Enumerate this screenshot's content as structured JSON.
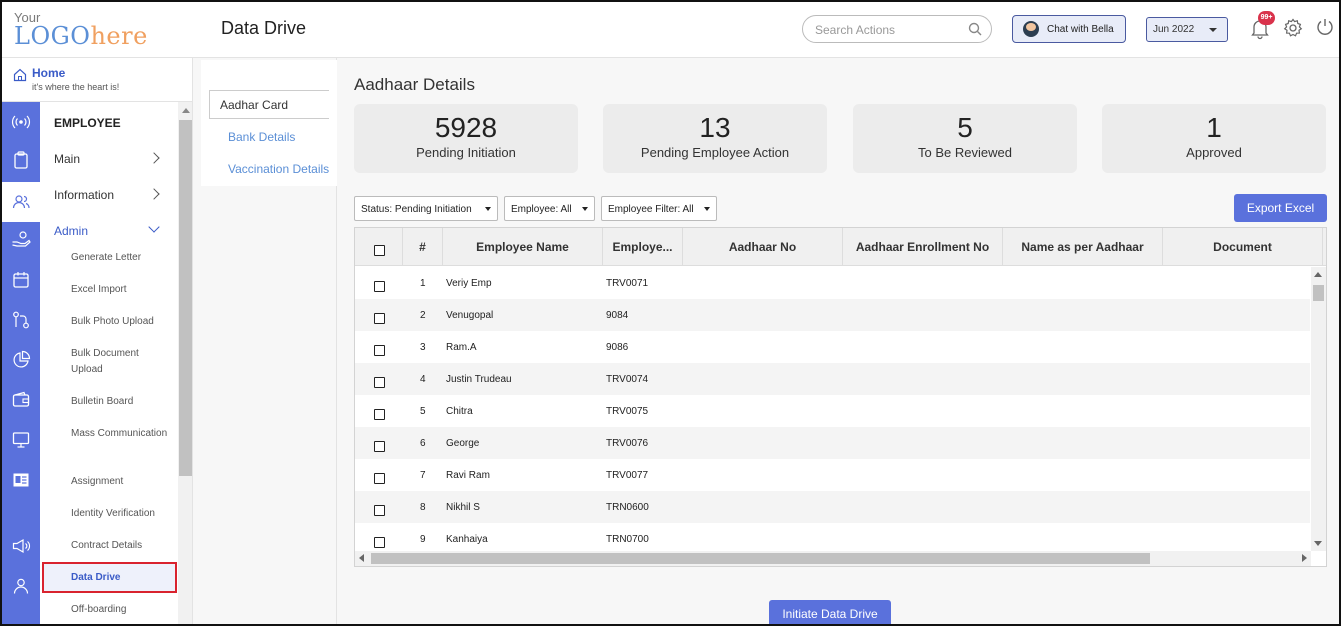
{
  "app": {
    "logo_top": "Your",
    "logo_main": "LOGO",
    "logo_suffix": "here",
    "page_title": "Data Drive"
  },
  "header": {
    "search_placeholder": "Search Actions",
    "chat_label": "Chat with Bella",
    "month_value": "Jun 2022",
    "notification_badge": "99+"
  },
  "home": {
    "title": "Home",
    "subtitle": "it's where the heart is!"
  },
  "sidebar": {
    "section": "EMPLOYEE",
    "groups": [
      {
        "label": "Main"
      },
      {
        "label": "Information"
      },
      {
        "label": "Admin"
      }
    ],
    "admin_items": [
      {
        "label": "Generate Letter"
      },
      {
        "label": "Excel Import"
      },
      {
        "label": "Bulk Photo Upload"
      },
      {
        "label": "Bulk Document Upload"
      },
      {
        "label": "Bulletin Board"
      },
      {
        "label": "Mass Communication"
      },
      {
        "label": "Assignment"
      },
      {
        "label": "Identity Verification"
      },
      {
        "label": "Contract Details"
      },
      {
        "label": "Data Drive"
      },
      {
        "label": "Off-boarding"
      }
    ]
  },
  "subnav": {
    "tabs": [
      {
        "label": "Aadhar Card"
      },
      {
        "label": "Bank Details"
      },
      {
        "label": "Vaccination Details"
      }
    ]
  },
  "main": {
    "heading": "Aadhaar Details",
    "cards": [
      {
        "value": "5928",
        "label": "Pending Initiation"
      },
      {
        "value": "13",
        "label": "Pending Employee Action"
      },
      {
        "value": "5",
        "label": "To Be Reviewed"
      },
      {
        "value": "1",
        "label": "Approved"
      }
    ],
    "filters": {
      "status": "Status: Pending Initiation",
      "employee": "Employee: All",
      "employee_filter": "Employee Filter: All"
    },
    "export_label": "Export Excel",
    "initiate_label": "Initiate Data Drive"
  },
  "table": {
    "columns": [
      "#",
      "Employee Name",
      "Employe...",
      "Aadhaar No",
      "Aadhaar Enrollment No",
      "Name as per Aadhaar",
      "Document"
    ],
    "rows": [
      {
        "n": "1",
        "name": "Veriy Emp",
        "code": "TRV0071"
      },
      {
        "n": "2",
        "name": "Venugopal",
        "code": "9084"
      },
      {
        "n": "3",
        "name": "Ram.A",
        "code": "9086"
      },
      {
        "n": "4",
        "name": "Justin Trudeau",
        "code": "TRV0074"
      },
      {
        "n": "5",
        "name": "Chitra",
        "code": "TRV0075"
      },
      {
        "n": "6",
        "name": "George",
        "code": "TRV0076"
      },
      {
        "n": "7",
        "name": "Ravi Ram",
        "code": "TRV0077"
      },
      {
        "n": "8",
        "name": "Nikhil S",
        "code": "TRN0600"
      },
      {
        "n": "9",
        "name": "Kanhaiya",
        "code": "TRN0700"
      }
    ]
  },
  "rail_icons": [
    "broadcast-icon",
    "clipboard-icon",
    "users-icon",
    "hand-coin-icon",
    "calendar-icon",
    "route-icon",
    "pie-chart-icon",
    "wallet-icon",
    "monitor-icon",
    "id-card-icon",
    "megaphone-icon",
    "user-icon"
  ],
  "colors": {
    "accent": "#5a71dc",
    "link": "#3a5bc7",
    "highlight_border": "#d9232e",
    "badge": "#d9324b"
  }
}
